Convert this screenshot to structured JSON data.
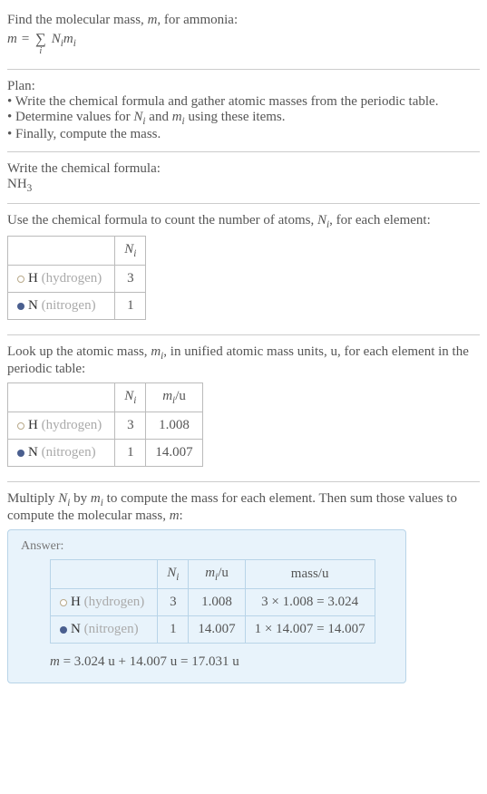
{
  "intro": {
    "line1_prefix": "Find the molecular mass, ",
    "line1_var": "m",
    "line1_suffix": ", for ammonia:",
    "formula_lhs": "m",
    "formula_eq": " = ",
    "formula_N": "N",
    "formula_i1": "i",
    "formula_m": "m",
    "formula_i2": "i",
    "sum_under": "i"
  },
  "plan": {
    "heading": "Plan:",
    "b1": "• Write the chemical formula and gather atomic masses from the periodic table.",
    "b2_pre": "• Determine values for ",
    "b2_N": "N",
    "b2_i1": "i",
    "b2_and": " and ",
    "b2_m": "m",
    "b2_i2": "i",
    "b2_post": " using these items.",
    "b3": "• Finally, compute the mass."
  },
  "step1": {
    "heading": "Write the chemical formula:",
    "nh": "NH",
    "nh_sub": "3"
  },
  "step2": {
    "text_pre": "Use the chemical formula to count the number of atoms, ",
    "text_N": "N",
    "text_i": "i",
    "text_post": ", for each element:",
    "col_N": "N",
    "col_i": "i",
    "rows": [
      {
        "sym": "H",
        "name": " (hydrogen)",
        "n": "3"
      },
      {
        "sym": "N",
        "name": " (nitrogen)",
        "n": "1"
      }
    ]
  },
  "step3": {
    "text_pre": "Look up the atomic mass, ",
    "text_m": "m",
    "text_i": "i",
    "text_mid": ", in unified atomic mass units, u, for each element in the periodic table:",
    "col_N": "N",
    "col_Ni": "i",
    "col_m": "m",
    "col_mi": "i",
    "col_mu": "/u",
    "rows": [
      {
        "sym": "H",
        "name": " (hydrogen)",
        "n": "3",
        "m": "1.008"
      },
      {
        "sym": "N",
        "name": " (nitrogen)",
        "n": "1",
        "m": "14.007"
      }
    ]
  },
  "step4": {
    "text_pre": "Multiply ",
    "text_N": "N",
    "text_Ni": "i",
    "text_by": " by ",
    "text_m": "m",
    "text_mi": "i",
    "text_mid": " to compute the mass for each element. Then sum those values to compute the molecular mass, ",
    "text_mvar": "m",
    "text_post": ":"
  },
  "answer": {
    "label": "Answer:",
    "col_N": "N",
    "col_Ni": "i",
    "col_m": "m",
    "col_mi": "i",
    "col_mu": "/u",
    "col_mass": "mass/u",
    "rows": [
      {
        "sym": "H",
        "name": " (hydrogen)",
        "n": "3",
        "m": "1.008",
        "mass": "3 × 1.008 = 3.024"
      },
      {
        "sym": "N",
        "name": " (nitrogen)",
        "n": "1",
        "m": "14.007",
        "mass": "1 × 14.007 = 14.007"
      }
    ],
    "result_pre": "m",
    "result": " = 3.024 u + 14.007 u = 17.031 u"
  }
}
